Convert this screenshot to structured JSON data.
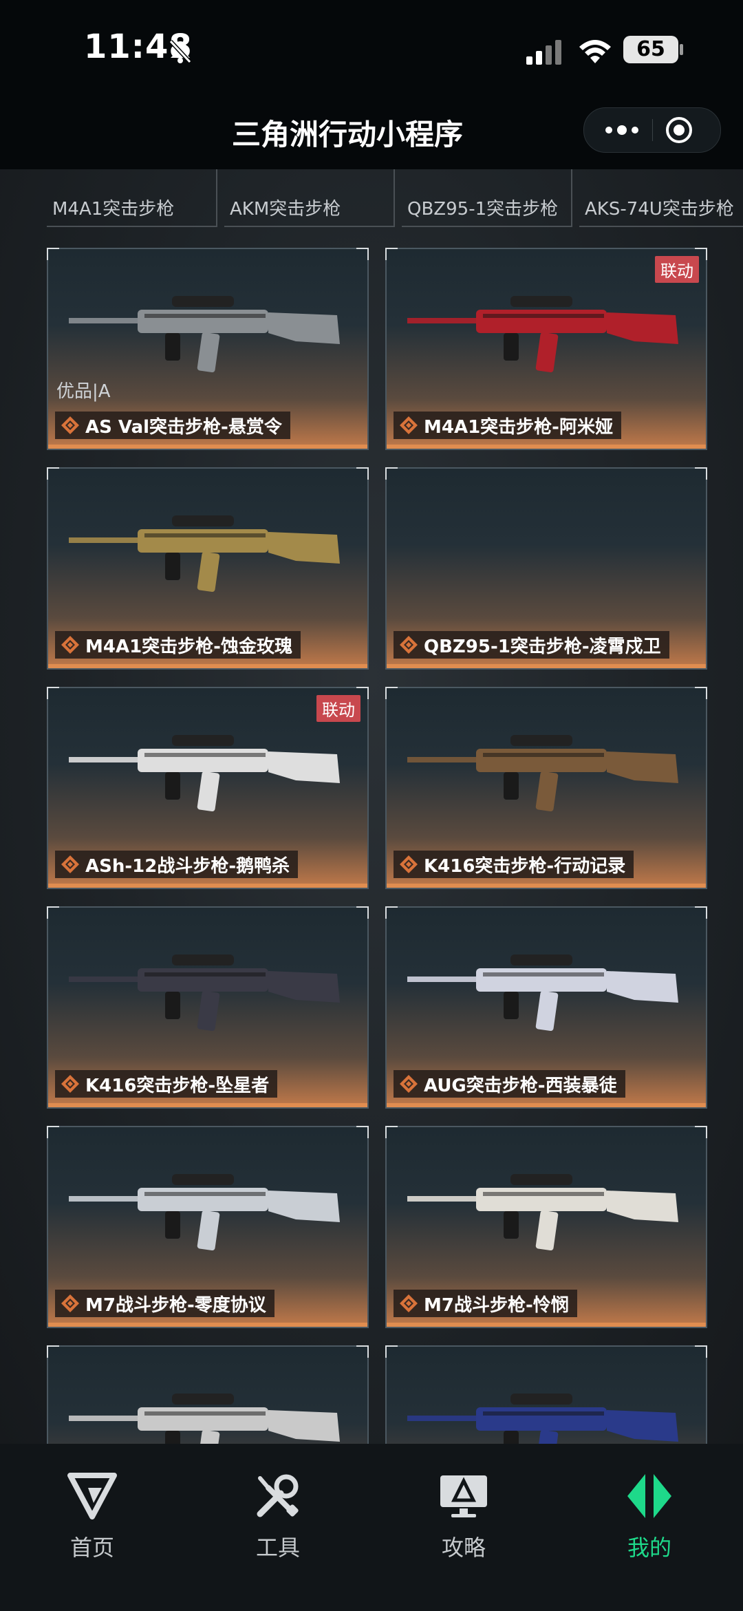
{
  "status_bar": {
    "time": "11:48",
    "battery": "65"
  },
  "header": {
    "title": "三角洲行动小程序"
  },
  "category_tabs": [
    "M4A1突击步枪",
    "AKM突击步枪",
    "QBZ95-1突击步枪",
    "AKS-74U突击步枪"
  ],
  "cards": [
    {
      "name": "AS Val突击步枪-悬赏令",
      "badge": "",
      "quality": "优品|A",
      "gun_color": "#8a8f93"
    },
    {
      "name": "M4A1突击步枪-阿米娅",
      "badge": "联动",
      "quality": "",
      "gun_color": "#b0202a"
    },
    {
      "name": "M4A1突击步枪-蚀金玫瑰",
      "badge": "",
      "quality": "",
      "gun_color": "#a38a4a"
    },
    {
      "name": "QBZ95-1突击步枪-凌霄戍卫",
      "badge": "",
      "quality": "",
      "gun_color": ""
    },
    {
      "name": "ASh-12战斗步枪-鹅鸭杀",
      "badge": "联动",
      "quality": "",
      "gun_color": "#dedede"
    },
    {
      "name": "K416突击步枪-行动记录",
      "badge": "",
      "quality": "",
      "gun_color": "#7a5a3a"
    },
    {
      "name": "K416突击步枪-坠星者",
      "badge": "",
      "quality": "",
      "gun_color": "#3a3a46"
    },
    {
      "name": "AUG突击步枪-西装暴徒",
      "badge": "",
      "quality": "",
      "gun_color": "#d0d3e0"
    },
    {
      "name": "M7战斗步枪-零度协议",
      "badge": "",
      "quality": "",
      "gun_color": "#c9ced4"
    },
    {
      "name": "M7战斗步枪-怜悯",
      "badge": "",
      "quality": "",
      "gun_color": "#e0ddd6"
    },
    {
      "name": "",
      "badge": "",
      "quality": "",
      "gun_color": "#c9c9c9"
    },
    {
      "name": "",
      "badge": "",
      "quality": "",
      "gun_color": "#2a3a8a"
    }
  ],
  "bottom_nav": [
    {
      "label": "首页",
      "icon": "home-logo-icon",
      "active": false
    },
    {
      "label": "工具",
      "icon": "tools-icon",
      "active": false
    },
    {
      "label": "攻略",
      "icon": "guide-monitor-icon",
      "active": false
    },
    {
      "label": "我的",
      "icon": "profile-logo-icon",
      "active": true
    }
  ],
  "colors": {
    "accent": "#1ed98a",
    "badge": "#c8484e",
    "card_bottom": "#e08d50"
  }
}
